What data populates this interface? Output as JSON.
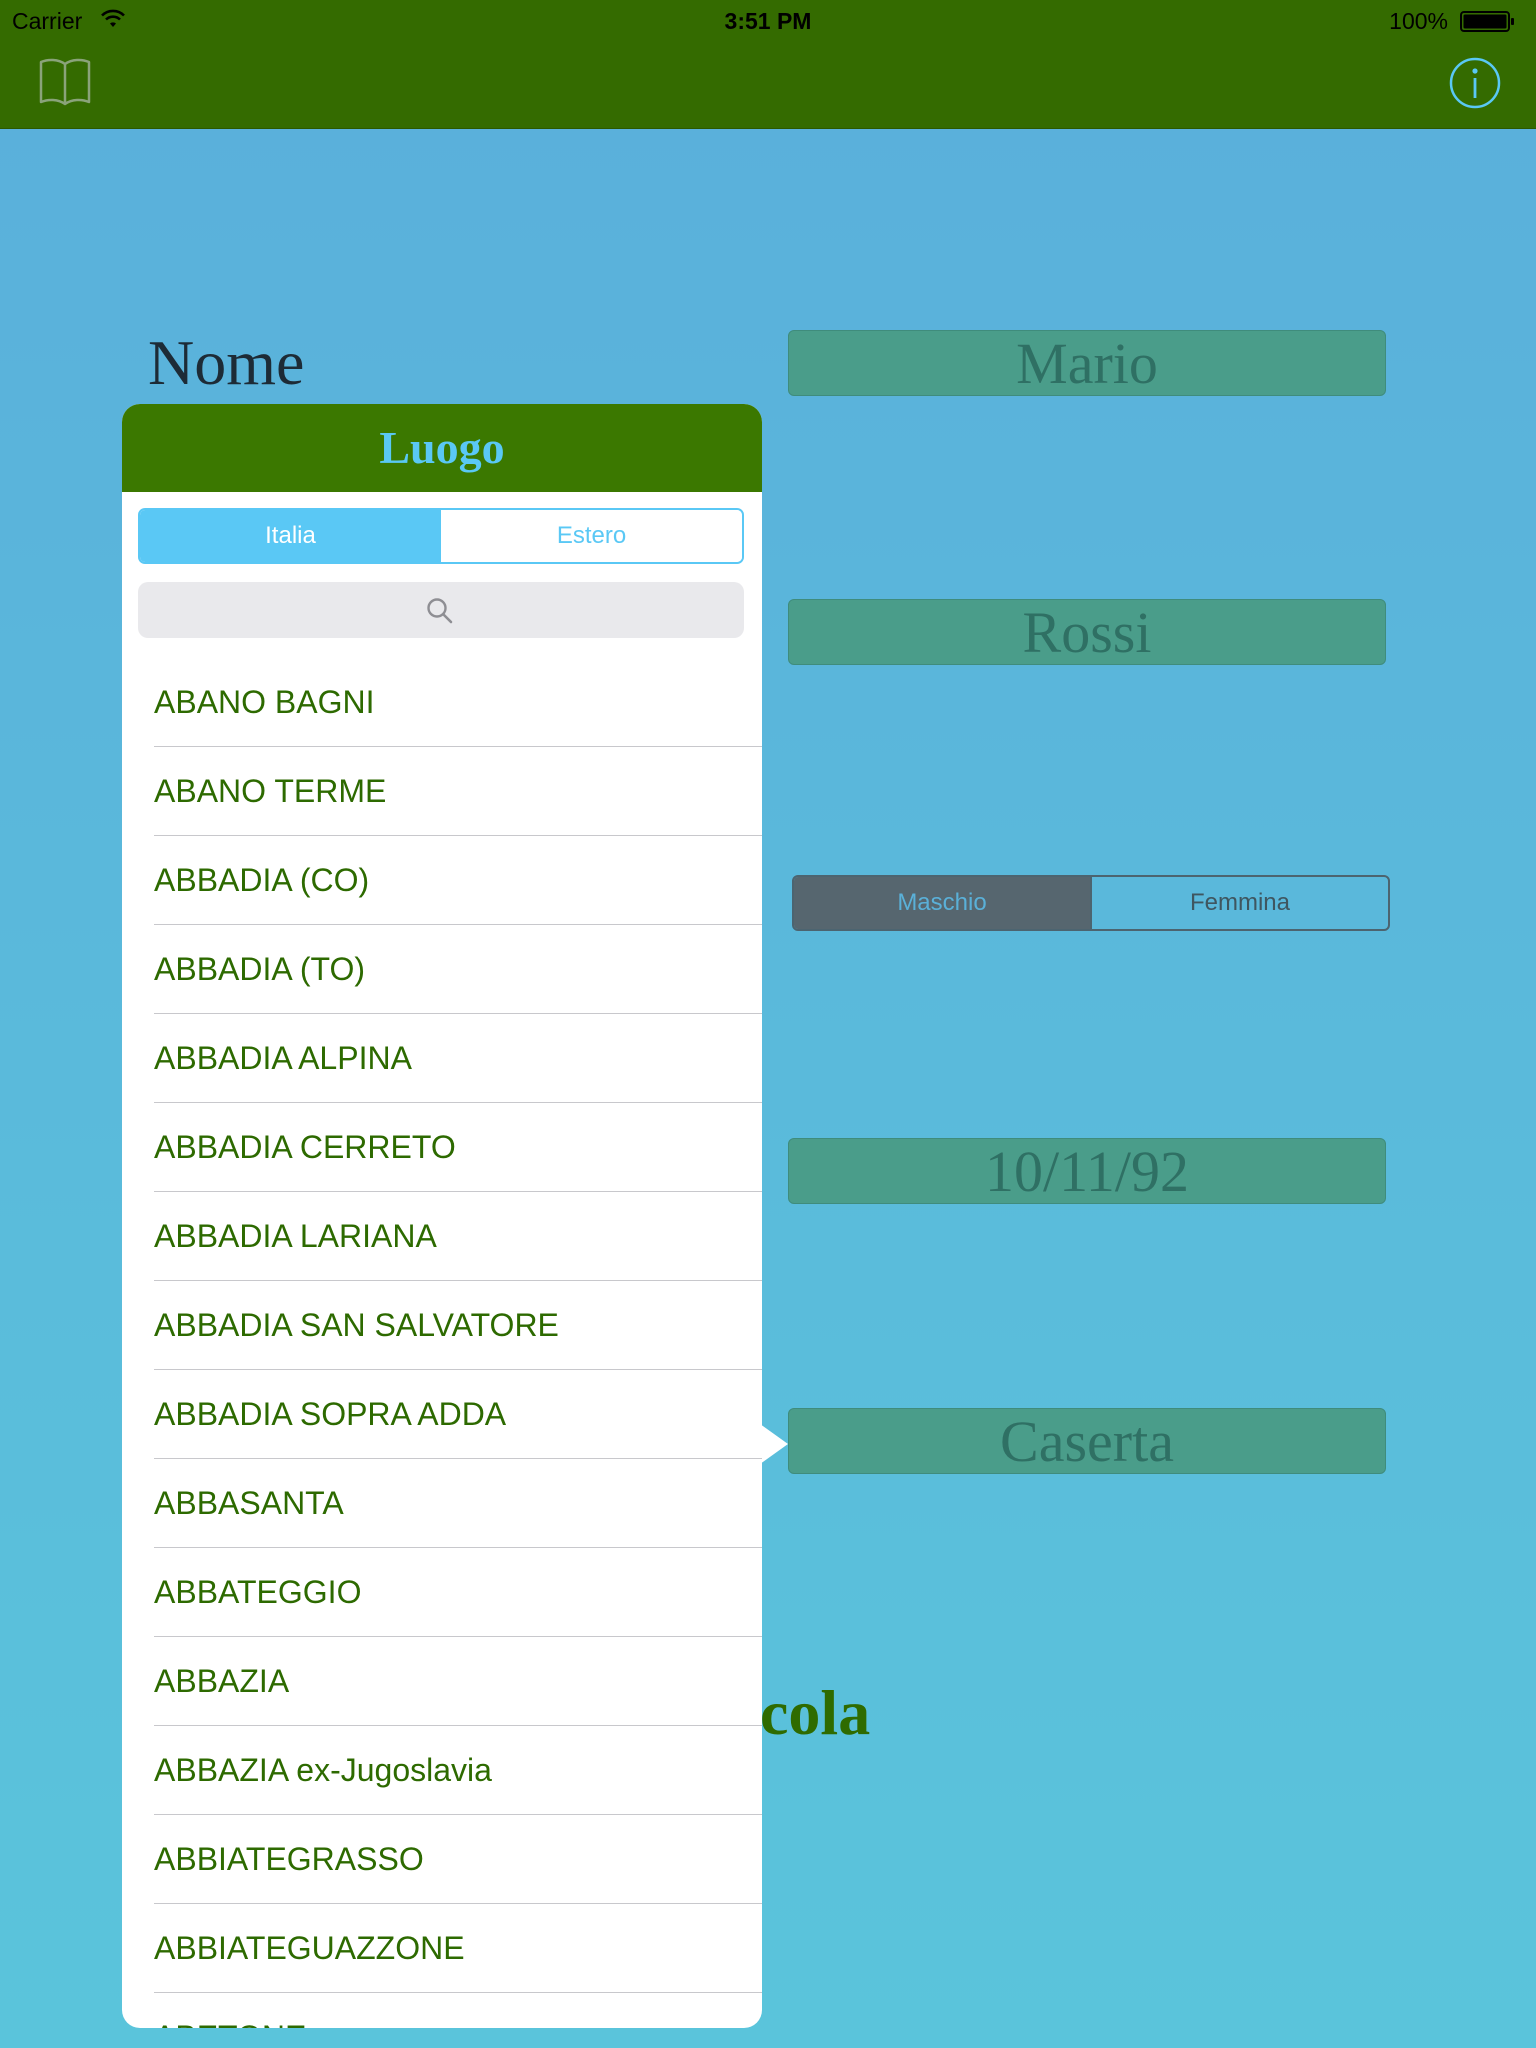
{
  "status": {
    "carrier": "Carrier",
    "time": "3:51 PM",
    "battery": "100%"
  },
  "icons": {
    "book": "book-icon",
    "info": "info-icon",
    "search": "search-icon",
    "wifi": "wifi-icon",
    "battery": "battery-icon"
  },
  "colors": {
    "bar": "#346b00",
    "accent": "#5ac8f5",
    "field": "#4a9d8a",
    "list_text": "#2d6a00"
  },
  "form": {
    "nome_label": "Nome",
    "nome_value": "Mario",
    "cognome_value": "Rossi",
    "gender": {
      "selected": "Maschio",
      "other": "Femmina"
    },
    "data_value": "10/11/92",
    "luogo_value": "Caserta",
    "calc_label_visible": "cola"
  },
  "popover": {
    "title": "Luogo",
    "segments": {
      "selected": "Italia",
      "other": "Estero"
    },
    "items": [
      "ABANO BAGNI",
      "ABANO TERME",
      "ABBADIA (CO)",
      "ABBADIA (TO)",
      "ABBADIA ALPINA",
      "ABBADIA CERRETO",
      "ABBADIA LARIANA",
      "ABBADIA SAN SALVATORE",
      "ABBADIA SOPRA ADDA",
      "ABBASANTA",
      "ABBATEGGIO",
      "ABBAZIA",
      "ABBAZIA ex-Jugoslavia",
      "ABBIATEGRASSO",
      "ABBIATEGUAZZONE",
      "ABETONE"
    ]
  }
}
